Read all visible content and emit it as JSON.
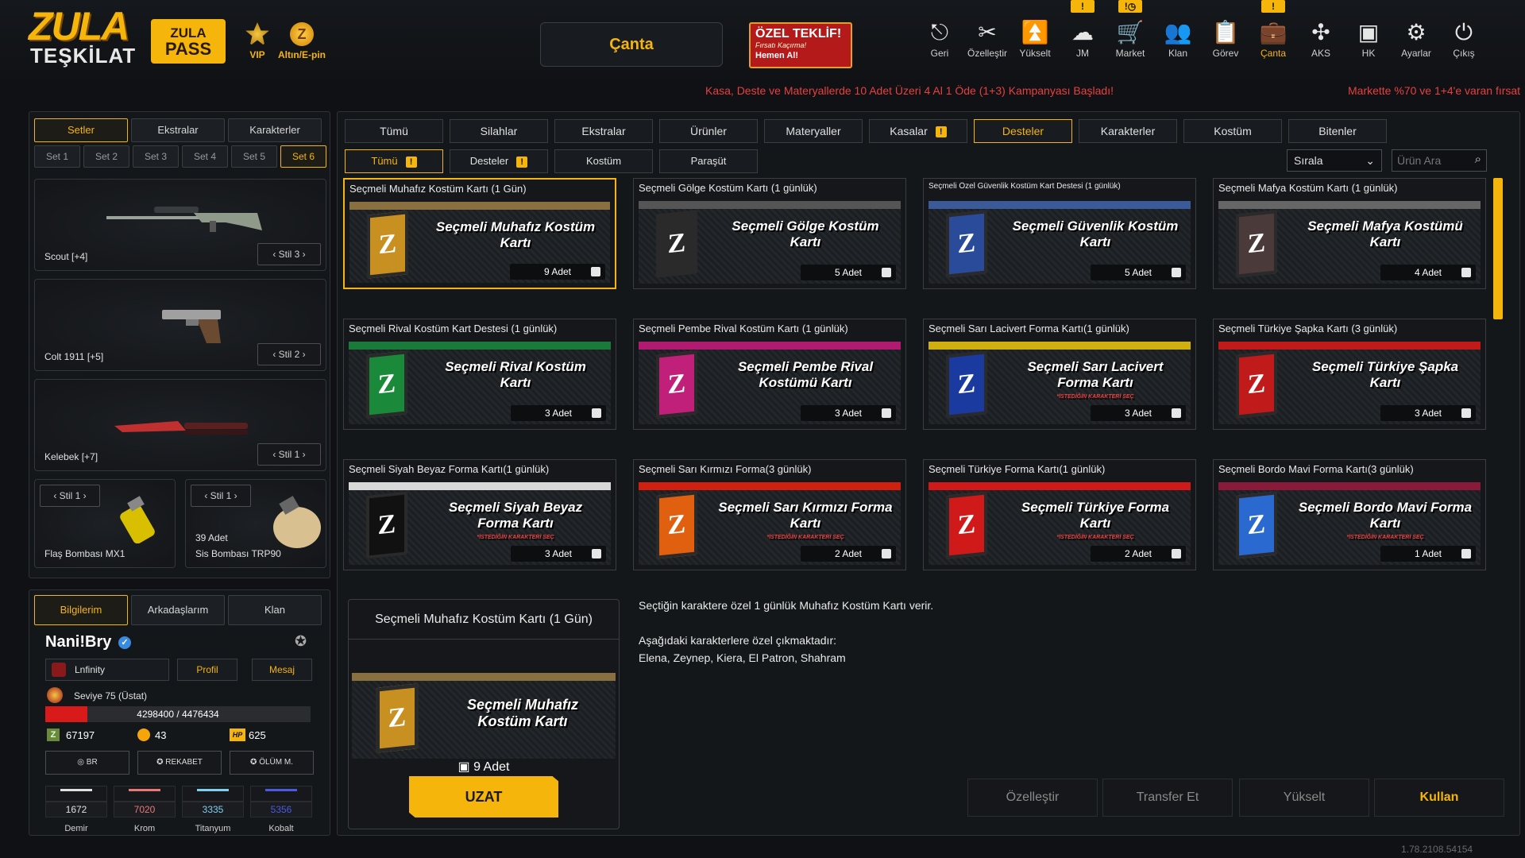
{
  "topbar": {
    "logo_line1": "ZULA",
    "logo_line2": "TEŞKİLAT",
    "pass_line1": "ZULA",
    "pass_line2": "PASS",
    "vip_label": "VIP",
    "altin_label": "Altın/E-pin",
    "canta_button": "Çanta",
    "offer": {
      "title": "ÖZEL TEKLİF!",
      "subtitle": "Fırsatı Kaçırma!",
      "cta": "Hemen Al!"
    },
    "nav": [
      {
        "label": "Geri",
        "icon": "back-icon",
        "glyph": "⎋"
      },
      {
        "label": "Özelleştir",
        "icon": "tools-icon",
        "glyph": "✂"
      },
      {
        "label": "Yükselt",
        "icon": "upgrade-icon",
        "glyph": "⏫"
      },
      {
        "label": "JM",
        "icon": "jm-icon",
        "glyph": "☁",
        "badge": "!"
      },
      {
        "label": "Market",
        "icon": "cart-icon",
        "glyph": "🛒",
        "badge": "!◷"
      },
      {
        "label": "Klan",
        "icon": "clan-icon",
        "glyph": "👥"
      },
      {
        "label": "Görev",
        "icon": "clipboard-icon",
        "glyph": "📋"
      },
      {
        "label": "Çanta",
        "icon": "bag-icon",
        "glyph": "💼",
        "badge": "!"
      },
      {
        "label": "AKS",
        "icon": "aks-icon",
        "glyph": "✣"
      },
      {
        "label": "HK",
        "icon": "wallet-icon",
        "glyph": "▣"
      },
      {
        "label": "Ayarlar",
        "icon": "gear-icon",
        "glyph": "⚙"
      },
      {
        "label": "Çıkış",
        "icon": "power-icon",
        "glyph": "⏻"
      }
    ],
    "promo1": "Kasa, Deste ve Materyallerde 10 Adet Üzeri 4 Al 1 Öde (1+3) Kampanyası Başladı!",
    "promo2": "Markette %70 ve 1+4'e varan fırsat"
  },
  "left": {
    "tabs": [
      "Setler",
      "Ekstralar",
      "Karakterler"
    ],
    "sets": [
      "Set 1",
      "Set 2",
      "Set 3",
      "Set 4",
      "Set 5",
      "Set 6"
    ],
    "weapons": [
      {
        "name": "Scout [+4]",
        "stil": "Stil 3"
      },
      {
        "name": "Colt 1911 [+5]",
        "stil": "Stil 2"
      },
      {
        "name": "Kelebek [+7]",
        "stil": "Stil 1"
      }
    ],
    "grenades": [
      {
        "name": "Flaş Bombası MX1",
        "stil": "Stil 1",
        "count": ""
      },
      {
        "name": "Sis Bombası TRP90",
        "stil": "Stil 1",
        "count": "39 Adet"
      }
    ]
  },
  "profile": {
    "tabs": [
      "Bilgilerim",
      "Arkadaşlarım",
      "Klan"
    ],
    "name": "Nani!Bry",
    "clan": "Lnfinity",
    "profil_btn": "Profil",
    "mesaj_btn": "Mesaj",
    "level": "Seviye 75 (Üstat)",
    "xp": "4298400 / 4476434",
    "xp_fraction": 0.16,
    "currency": {
      "z": "67197",
      "gold": "43",
      "hp": "625"
    },
    "hp_tag": "HP",
    "modes": [
      "BR",
      "REKABET",
      "ÖLÜM M."
    ],
    "materials": [
      {
        "value": "1672",
        "label": "Demir",
        "color": "#e0e0e0"
      },
      {
        "value": "7020",
        "label": "Krom",
        "color": "#e87878"
      },
      {
        "value": "3335",
        "label": "Titanyum",
        "color": "#7fd0ee"
      },
      {
        "value": "5356",
        "label": "Kobalt",
        "color": "#4a5ae0"
      }
    ]
  },
  "center": {
    "tabs": [
      "Tümü",
      "Silahlar",
      "Ekstralar",
      "Ürünler",
      "Materyaller",
      "Kasalar",
      "Desteler",
      "Karakterler",
      "Kostüm",
      "Bitenler"
    ],
    "subtabs": [
      "Tümü",
      "Desteler",
      "Kostüm",
      "Paraşüt"
    ],
    "sort_label": "Sırala",
    "search_placeholder": "Ürün Ara",
    "items": [
      {
        "title": "Seçmeli Muhafız Kostüm Kartı (1 Gün)",
        "caption": "Seçmeli Muhafız Kostüm Kartı",
        "sub": "",
        "count": "9 Adet",
        "color": "#c89020",
        "stripe": "#8a7040"
      },
      {
        "title": "Seçmeli Gölge Kostüm Kartı (1 günlük)",
        "caption": "Seçmeli Gölge Kostüm Kartı",
        "sub": "",
        "count": "5 Adet",
        "color": "#2a2a2a",
        "stripe": "#555555"
      },
      {
        "title": "Seçmeli Özel Güvenlik Kostüm Kart Destesi (1 günlük)",
        "caption": "Seçmeli Güvenlik Kostüm Kartı",
        "sub": "",
        "count": "5 Adet",
        "color": "#2a4a9a",
        "stripe": "#3a5a9a"
      },
      {
        "title": "Seçmeli Mafya Kostüm Kartı (1 günlük)",
        "caption": "Seçmeli Mafya Kostümü Kartı",
        "sub": "",
        "count": "4 Adet",
        "color": "#4a3a3a",
        "stripe": "#666666"
      },
      {
        "title": "Seçmeli Rival Kostüm Kart Destesi (1 günlük)",
        "caption": "Seçmeli Rival Kostüm Kartı",
        "sub": "",
        "count": "3 Adet",
        "color": "#1a8a3a",
        "stripe": "#1a7a3a"
      },
      {
        "title": "Seçmeli Pembe Rival Kostüm Kartı (1 günlük)",
        "caption": "Seçmeli Pembe Rival Kostümü Kartı",
        "sub": "",
        "count": "3 Adet",
        "color": "#c0207a",
        "stripe": "#b01a70"
      },
      {
        "title": "Seçmeli Sarı Lacivert Forma Kartı(1 günlük)",
        "caption": "Seçmeli Sarı Lacivert Forma Kartı",
        "sub": "*İSTEDİĞİN KARAKTERİ SEÇ",
        "count": "3 Adet",
        "color": "#1a3aa0",
        "stripe": "#d0b010"
      },
      {
        "title": "Seçmeli Türkiye Şapka Kartı (3 günlük)",
        "caption": "Seçmeli Türkiye Şapka Kartı",
        "sub": "",
        "count": "3 Adet",
        "color": "#c01a1a",
        "stripe": "#c01a1a"
      },
      {
        "title": "Seçmeli Siyah Beyaz Forma Kartı(1 günlük)",
        "caption": "Seçmeli Siyah Beyaz Forma Kartı",
        "sub": "*İSTEDİĞİN KARAKTERİ SEÇ",
        "count": "3 Adet",
        "color": "#111111",
        "stripe": "#d8d8d8"
      },
      {
        "title": "Seçmeli Sarı Kırmızı Forma(3 günlük)",
        "caption": "Seçmeli Sarı Kırmızı Forma Kartı",
        "sub": "*İSTEDİĞİN KARAKTERİ SEÇ",
        "count": "2 Adet",
        "color": "#e06010",
        "stripe": "#d02010"
      },
      {
        "title": "Seçmeli Türkiye Forma Kartı(1 günlük)",
        "caption": "Seçmeli Türkiye Forma Kartı",
        "sub": "*İSTEDİĞİN KARAKTERİ SEÇ",
        "count": "2 Adet",
        "color": "#d01a1a",
        "stripe": "#d01a1a"
      },
      {
        "title": "Seçmeli Bordo Mavi Forma Kartı(3 günlük)",
        "caption": "Seçmeli Bordo Mavi Forma Kartı",
        "sub": "*İSTEDİĞİN KARAKTERİ SEÇ",
        "count": "1 Adet",
        "color": "#2a6ad0",
        "stripe": "#8a1a3a"
      }
    ],
    "selected_index": 0,
    "detail": {
      "title": "Seçmeli Muhafız Kostüm Kartı (1 Gün)",
      "caption": "Seçmeli Muhafız Kostüm Kartı",
      "count": "9 Adet",
      "uzat": "UZAT",
      "desc1": "Seçtiğin karaktere özel 1 günlük Muhafız Kostüm Kartı verir.",
      "desc2": "Aşağıdaki karakterlere özel çıkmaktadır:",
      "desc3": "Elena, Zeynep, Kiera, El Patron, Shahram"
    },
    "actions": [
      "Özelleştir",
      "Transfer Et",
      "Yükselt",
      "Kullan"
    ],
    "version": "1.78.2108.54154"
  },
  "colors": {
    "accent": "#f5b50a",
    "promo": "#e84040",
    "bg": "#0f1114"
  }
}
